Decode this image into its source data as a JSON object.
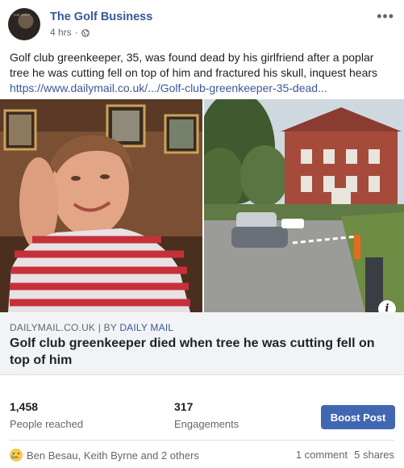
{
  "post": {
    "page_name": "The Golf Business",
    "time": "4 hrs",
    "separator": "·",
    "audience_icon": "globe-icon",
    "more_icon": "more-options-icon",
    "text_prefix": "Golf club greenkeeper, 35, was found dead by his girlfriend after a poplar tree he was cutting fell on top of him and fractured his skull, inquest hears ",
    "link_text": "https://www.dailymail.co.uk/.../Golf-club-greenkeeper-35-dead..."
  },
  "link_card": {
    "domain": "DAILYMAIL.CO.UK",
    "divider": "|",
    "by_label": "BY",
    "author": "DAILY MAIL",
    "title": "Golf club greenkeeper died when tree he was cutting fell on top of him",
    "info_icon": "info-icon"
  },
  "stats": {
    "reached_value": "1,458",
    "reached_label": "People reached",
    "engagements_value": "317",
    "engagements_label": "Engagements",
    "boost_label": "Boost Post"
  },
  "footer": {
    "reaction_icon": "sad-reaction-icon",
    "reactors": "Ben Besau, Keith Byrne and 2 others",
    "comments": "1 comment",
    "shares": "5 shares"
  },
  "colors": {
    "link": "#385898",
    "boost_button": "#4267b2",
    "card_footer_bg": "#f2f3f5"
  }
}
